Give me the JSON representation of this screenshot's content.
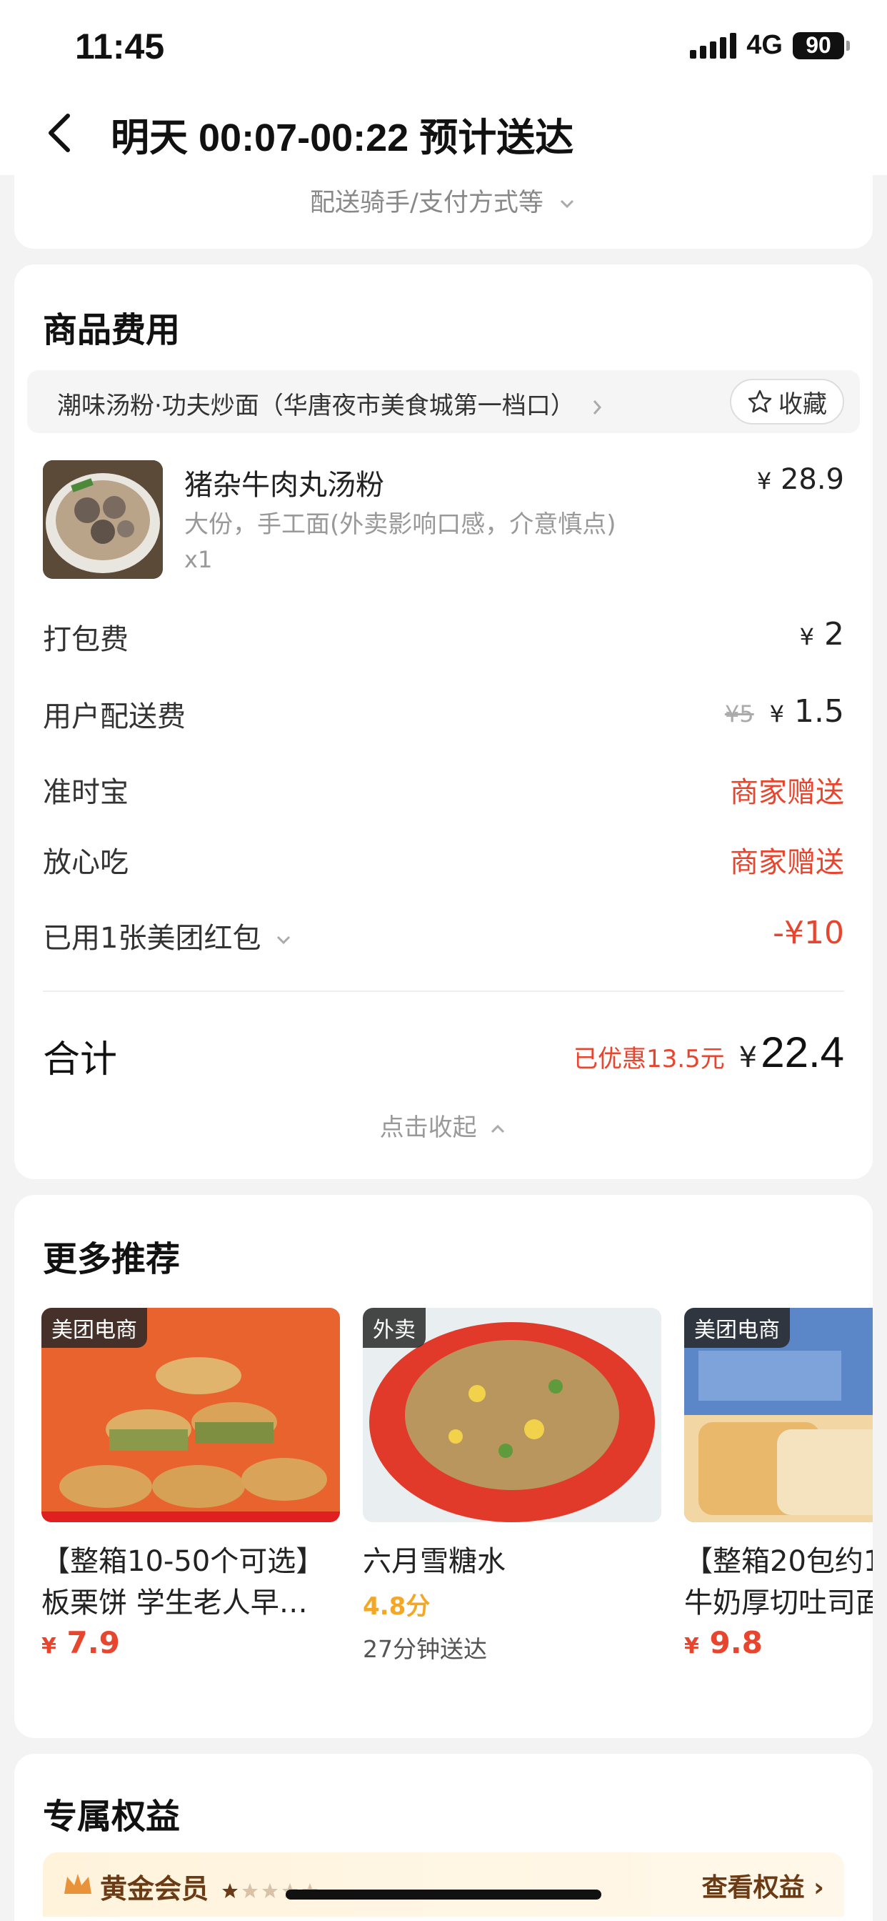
{
  "status_bar": {
    "time": "11:45",
    "network": "4G",
    "battery": "90"
  },
  "nav": {
    "title": "明天 00:07-00:22 预计送达"
  },
  "delivery_card": {
    "collapse_label": "配送骑手/支付方式等"
  },
  "fee_card": {
    "title": "商品费用",
    "shop_name": "潮味汤粉·功夫炒面（华唐夜市美食城第一档口）",
    "favorite_label": "收藏",
    "product": {
      "name": "猪杂牛肉丸汤粉",
      "spec": "大份，手工面(外卖影响口感，介意慎点)",
      "qty": "x1",
      "currency": "¥",
      "price": "28.9"
    },
    "fees": [
      {
        "label": "打包费",
        "currency": "¥",
        "value": "2"
      },
      {
        "label": "用户配送费",
        "original": "¥5",
        "currency": "¥",
        "value": "1.5"
      },
      {
        "label": "准时宝",
        "value": "商家赠送"
      },
      {
        "label": "放心吃",
        "value": "商家赠送"
      },
      {
        "label": "已用1张美团红包",
        "value": "-¥10"
      }
    ],
    "total_label": "合计",
    "discount": "已优惠13.5元",
    "total_currency": "¥",
    "total_value": "22.4",
    "fold_label": "点击收起"
  },
  "recommend": {
    "title": "更多推荐",
    "items": [
      {
        "tag": "美团电商",
        "title_line1": "【整箱10-50个可选】",
        "title_line2": "板栗饼  学生老人早…",
        "currency": "¥",
        "price": "7.9"
      },
      {
        "tag": "外卖",
        "title_line1": "六月雪糖水",
        "rating": "4.8分",
        "eta": "27分钟送达"
      },
      {
        "tag": "美团电商",
        "title_line1": "【整箱20包约1",
        "title_line2": "牛奶厚切吐司面",
        "currency": "¥",
        "price": "9.8"
      }
    ]
  },
  "benefits": {
    "title": "专属权益",
    "member_label": "黄金会员",
    "view_link": "查看权益 ›"
  },
  "colors": {
    "accent_red": "#e8452f",
    "rating_orange": "#f5a623",
    "gold_text": "#6a3b14"
  }
}
